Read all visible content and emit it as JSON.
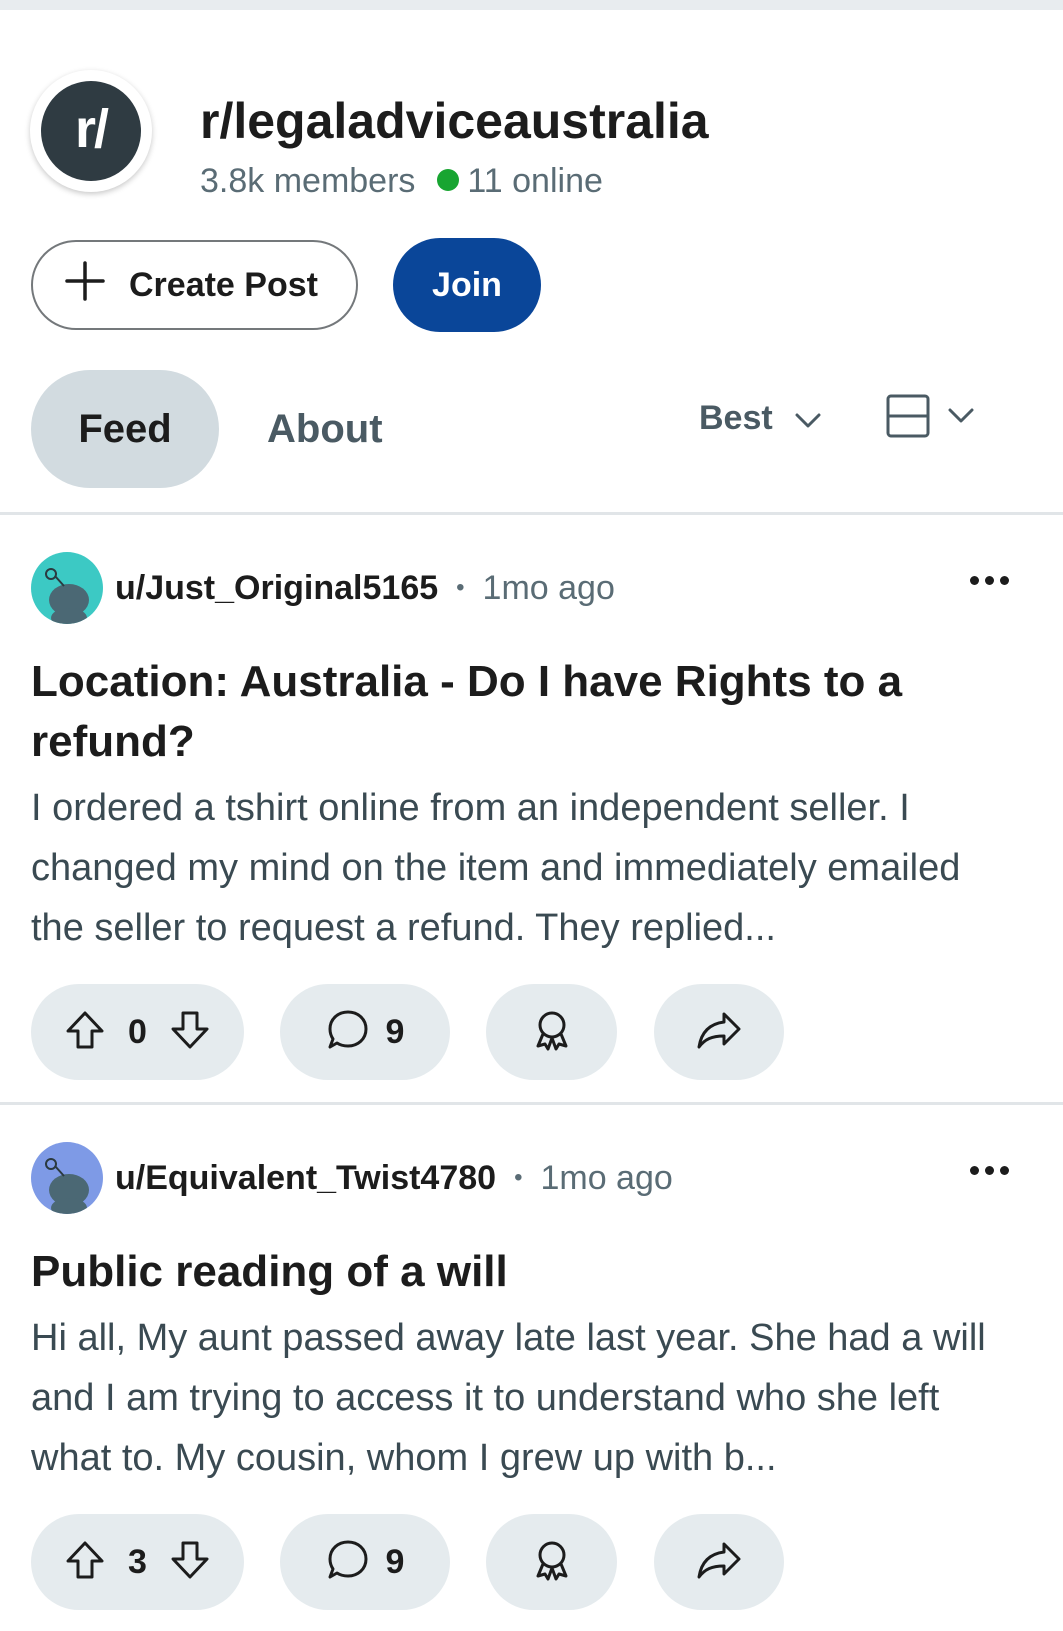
{
  "subreddit": {
    "avatar_text": "r/",
    "name": "r/legaladviceaustralia",
    "members": "3.8k members",
    "online": "11 online",
    "colors": {
      "avatar_bg": "#2f3b42",
      "online_dot": "#18a531"
    }
  },
  "actions": {
    "create_post": "Create Post",
    "join": "Join",
    "join_color": "#0a4699"
  },
  "tabs": {
    "feed": "Feed",
    "about": "About"
  },
  "sort": {
    "label": "Best"
  },
  "posts": [
    {
      "username": "u/Just_Original5165",
      "time": "1mo ago",
      "title": "Location: Australia - Do I have Rights to a refund?",
      "body": "I ordered a tshirt online from an independent seller. I changed my mind on the item and immediately emailed the seller to request a refund. They replied...",
      "votes": "0",
      "comments": "9",
      "avatar_color": "#3cc9c4"
    },
    {
      "username": "u/Equivalent_Twist4780",
      "time": "1mo ago",
      "title": "Public reading of a will",
      "body": "Hi all, My aunt passed away late last year. She had a will and I am trying to access it to understand who she left what to. My cousin, whom I grew up with b...",
      "votes": "3",
      "comments": "9",
      "avatar_color": "#7e9ae6"
    }
  ],
  "icons": [
    "plus-icon",
    "chevron-down-icon",
    "card-view-icon",
    "more-options-icon",
    "upvote-icon",
    "downvote-icon",
    "comment-icon",
    "award-icon",
    "share-icon",
    "snoo-avatar-icon"
  ]
}
